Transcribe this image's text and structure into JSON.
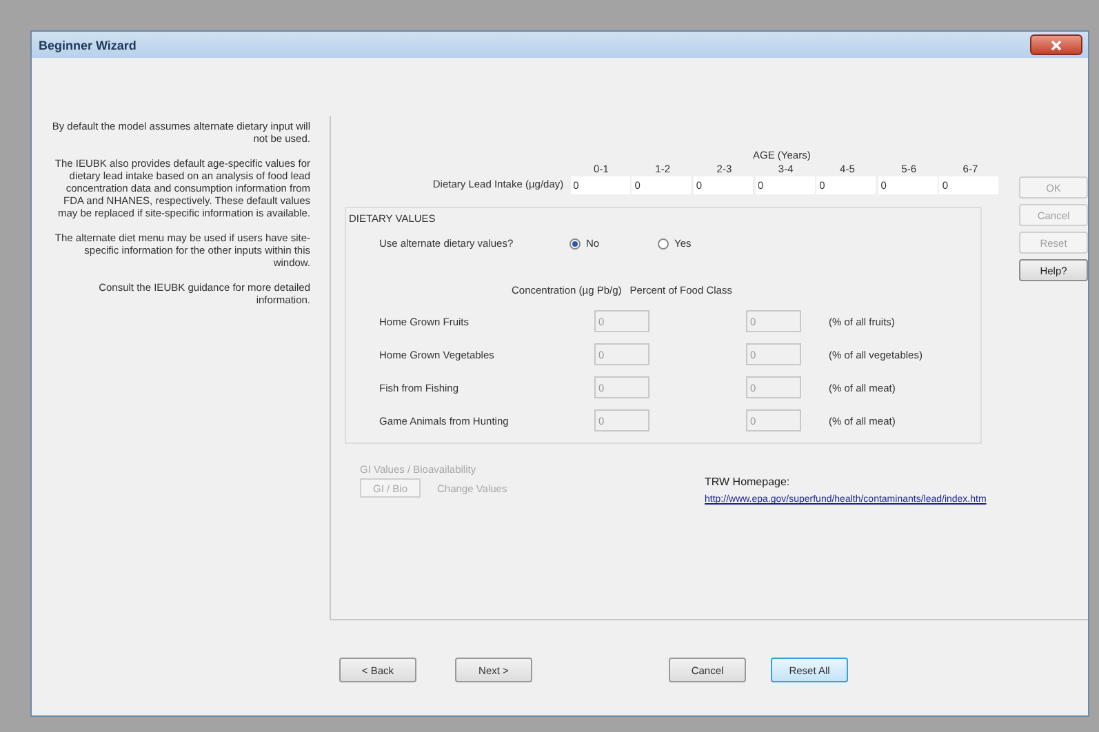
{
  "window": {
    "title": "Beginner Wizard"
  },
  "info_paragraphs": [
    "By default the model assumes alternate dietary input will not be used.",
    "The IEUBK also provides default age-specific values for dietary lead intake based on an analysis of food lead concentration data and consumption information from FDA and NHANES, respectively. These default values may be replaced if site-specific information is available.",
    "The alternate diet menu may be used if users have site-specific information for the other inputs within this window.",
    "Consult the IEUBK guidance for more detailed information."
  ],
  "age_header": "AGE (Years)",
  "intake_label": "Dietary Lead Intake (µg/day)",
  "age_groups": [
    {
      "label": "0-1",
      "value": "0"
    },
    {
      "label": "1-2",
      "value": "0"
    },
    {
      "label": "2-3",
      "value": "0"
    },
    {
      "label": "3-4",
      "value": "0"
    },
    {
      "label": "4-5",
      "value": "0"
    },
    {
      "label": "5-6",
      "value": "0"
    },
    {
      "label": "6-7",
      "value": "0"
    }
  ],
  "dietary_values": {
    "title": "DIETARY VALUES",
    "question": "Use alternate dietary values?",
    "options": [
      {
        "label": "No",
        "selected": true
      },
      {
        "label": "Yes",
        "selected": false
      }
    ],
    "column_headers": [
      "Concentration (µg Pb/g)",
      "Percent of Food Class"
    ],
    "rows": [
      {
        "label": "Home Grown Fruits",
        "concentration": "0",
        "percent": "0",
        "unit": "(% of all fruits)",
        "disabled": true
      },
      {
        "label": "Home Grown Vegetables",
        "concentration": "0",
        "percent": "0",
        "unit": "(% of all vegetables)",
        "disabled": true
      },
      {
        "label": "Fish from Fishing",
        "concentration": "0",
        "percent": "0",
        "unit": "(% of all meat)",
        "disabled": true
      },
      {
        "label": "Game Animals from Hunting",
        "concentration": "0",
        "percent": "0",
        "unit": "(% of all meat)",
        "disabled": true
      }
    ]
  },
  "side_buttons": [
    {
      "label": "OK",
      "disabled": true
    },
    {
      "label": "Cancel",
      "disabled": true
    },
    {
      "label": "Reset",
      "disabled": true
    },
    {
      "label": "Help?",
      "disabled": false
    }
  ],
  "gi": {
    "title": "GI Values / Bioavailability",
    "button": "GI / Bio",
    "link": "Change Values",
    "disabled": true
  },
  "homepage": {
    "label": "TRW Homepage:",
    "url": "http://www.epa.gov/superfund/health/contaminants/lead/index.htm"
  },
  "footer_buttons": [
    {
      "label": "< Back",
      "focused": false
    },
    {
      "label": "Next >",
      "focused": false
    },
    {
      "label": "Cancel",
      "focused": false
    },
    {
      "label": "Reset All",
      "focused": true
    }
  ]
}
